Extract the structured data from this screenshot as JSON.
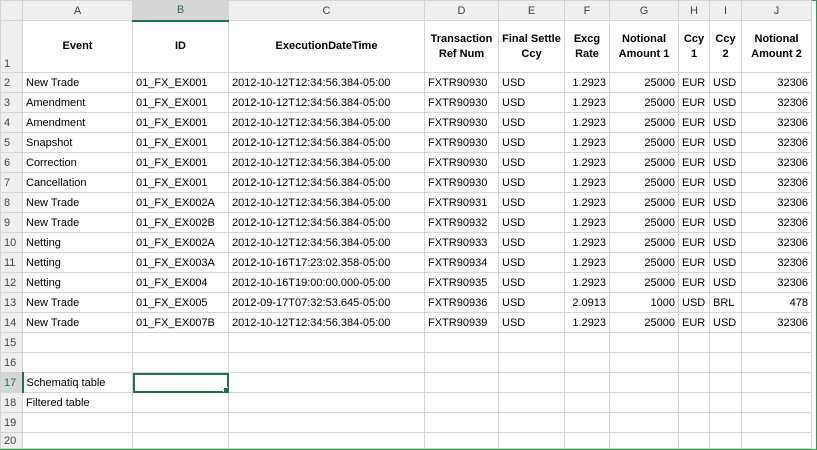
{
  "columns": [
    "A",
    "B",
    "C",
    "D",
    "E",
    "F",
    "G",
    "H",
    "I",
    "J"
  ],
  "header_row": {
    "row_number": "1",
    "cells": [
      "Event",
      "ID",
      "ExecutionDateTime",
      "Transaction Ref Num",
      "Final Settle Ccy",
      "Excg Rate",
      "Notional Amount 1",
      "Ccy 1",
      "Ccy 2",
      "Notional Amount 2"
    ]
  },
  "data_rows": [
    {
      "row_number": "2",
      "cells": [
        "New Trade",
        "01_FX_EX001",
        "2012-10-12T12:34:56.384-05:00",
        "FXTR90930",
        "USD",
        "1.2923",
        "25000",
        "EUR",
        "USD",
        "32306"
      ]
    },
    {
      "row_number": "3",
      "cells": [
        "Amendment",
        "01_FX_EX001",
        "2012-10-12T12:34:56.384-05:00",
        "FXTR90930",
        "USD",
        "1.2923",
        "25000",
        "EUR",
        "USD",
        "32306"
      ]
    },
    {
      "row_number": "4",
      "cells": [
        "Amendment",
        "01_FX_EX001",
        "2012-10-12T12:34:56.384-05:00",
        "FXTR90930",
        "USD",
        "1.2923",
        "25000",
        "EUR",
        "USD",
        "32306"
      ]
    },
    {
      "row_number": "5",
      "cells": [
        "Snapshot",
        "01_FX_EX001",
        "2012-10-12T12:34:56.384-05:00",
        "FXTR90930",
        "USD",
        "1.2923",
        "25000",
        "EUR",
        "USD",
        "32306"
      ]
    },
    {
      "row_number": "6",
      "cells": [
        "Correction",
        "01_FX_EX001",
        "2012-10-12T12:34:56.384-05:00",
        "FXTR90930",
        "USD",
        "1.2923",
        "25000",
        "EUR",
        "USD",
        "32306"
      ]
    },
    {
      "row_number": "7",
      "cells": [
        "Cancellation",
        "01_FX_EX001",
        "2012-10-12T12:34:56.384-05:00",
        "FXTR90930",
        "USD",
        "1.2923",
        "25000",
        "EUR",
        "USD",
        "32306"
      ]
    },
    {
      "row_number": "8",
      "cells": [
        "New Trade",
        "01_FX_EX002A",
        "2012-10-12T12:34:56.384-05:00",
        "FXTR90931",
        "USD",
        "1.2923",
        "25000",
        "EUR",
        "USD",
        "32306"
      ]
    },
    {
      "row_number": "9",
      "cells": [
        "New Trade",
        "01_FX_EX002B",
        "2012-10-12T12:34:56.384-05:00",
        "FXTR90932",
        "USD",
        "1.2923",
        "25000",
        "EUR",
        "USD",
        "32306"
      ]
    },
    {
      "row_number": "10",
      "cells": [
        "Netting",
        "01_FX_EX002A",
        "2012-10-12T12:34:56.384-05:00",
        "FXTR90933",
        "USD",
        "1.2923",
        "25000",
        "EUR",
        "USD",
        "32306"
      ]
    },
    {
      "row_number": "11",
      "cells": [
        "Netting",
        "01_FX_EX003A",
        "2012-10-16T17:23:02.358-05:00",
        "FXTR90934",
        "USD",
        "1.2923",
        "25000",
        "EUR",
        "USD",
        "32306"
      ]
    },
    {
      "row_number": "12",
      "cells": [
        "Netting",
        "01_FX_EX004",
        "2012-10-16T19:00:00.000-05:00",
        "FXTR90935",
        "USD",
        "1.2923",
        "25000",
        "EUR",
        "USD",
        "32306"
      ]
    },
    {
      "row_number": "13",
      "cells": [
        "New Trade",
        "01_FX_EX005",
        "2012-09-17T07:32:53.645-05:00",
        "FXTR90936",
        "USD",
        "2.0913",
        "1000",
        "USD",
        "BRL",
        "478"
      ]
    },
    {
      "row_number": "14",
      "cells": [
        "New Trade",
        "01_FX_EX007B",
        "2012-10-12T12:34:56.384-05:00",
        "FXTR90939",
        "USD",
        "1.2923",
        "25000",
        "EUR",
        "USD",
        "32306"
      ]
    }
  ],
  "empty_rows": [
    "15",
    "16"
  ],
  "label_rows": [
    {
      "row_number": "17",
      "label": "Schematiq table"
    },
    {
      "row_number": "18",
      "label": "Filtered table"
    }
  ],
  "trailing_rows": [
    "19",
    "20"
  ],
  "active_cell": {
    "column": "B",
    "row": "17"
  },
  "colors": {
    "accent": "#217346",
    "frame": "#1fa347",
    "gridline": "#d4d4d4",
    "header_bg": "#efefef"
  }
}
